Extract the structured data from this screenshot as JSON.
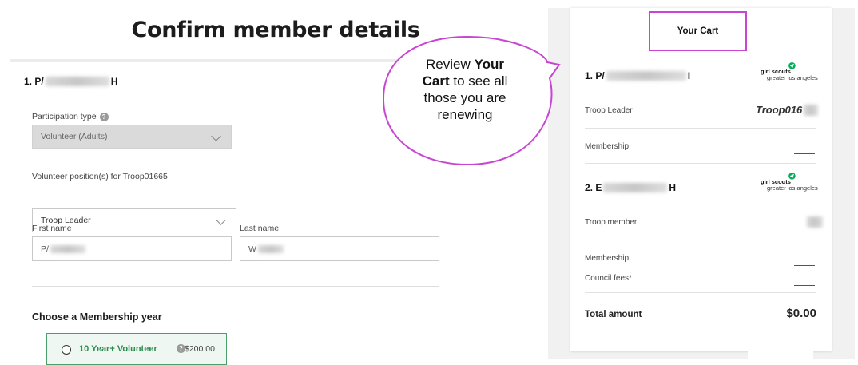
{
  "form": {
    "title": "Confirm member details",
    "member_heading_prefix": "1. P/",
    "member_heading_suffix": "H",
    "participation_type_label": "Participation type",
    "participation_type_value": "Volunteer (Adults)",
    "volunteer_position_label": "Volunteer position(s) for Troop01665",
    "volunteer_position_value": "Troop Leader",
    "first_name_label": "First name",
    "first_name_value": "P/",
    "last_name_label": "Last name",
    "last_name_value": "W",
    "membership_year_heading": "Choose a Membership year",
    "option_label": "10 Year+ Volunteer",
    "option_price": "$200.00"
  },
  "callout": {
    "line1_pre": "Review ",
    "line1_bold": "Your",
    "line2_bold": "Cart",
    "line2_post": " to see all",
    "line3": "those you are",
    "line4": "renewing"
  },
  "cart": {
    "title": "Your Cart",
    "members": [
      {
        "name_prefix": "1. P/",
        "name_suffix": "I",
        "logo_line1": "girl scouts",
        "logo_line2": "greater los angeles",
        "role": "Troop Leader",
        "role_value": "Troop016",
        "membership_label": "Membership"
      },
      {
        "name_prefix": "2. E",
        "name_suffix": "H",
        "logo_line1": "girl scouts",
        "logo_line2": "greater los angeles",
        "role": "Troop member",
        "membership_label": "Membership",
        "fees_label": "Council fees*"
      }
    ],
    "total_label": "Total amount",
    "total_value": "$0.00"
  },
  "colors": {
    "callout_border": "#c844d2",
    "option_green": "#2e8b4e",
    "brand_green": "#00ae58"
  }
}
